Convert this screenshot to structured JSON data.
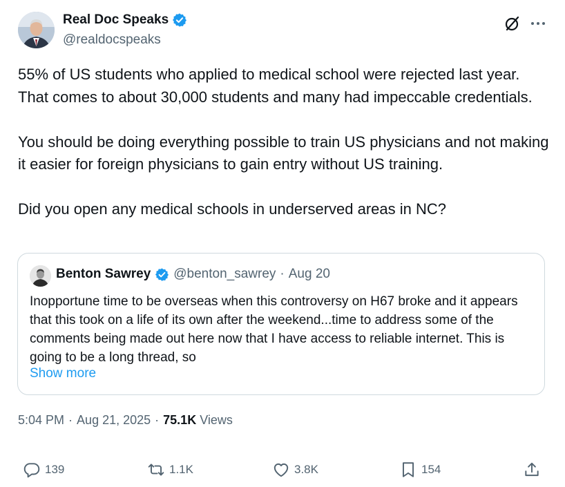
{
  "author": {
    "display_name": "Real Doc Speaks",
    "handle": "@realdocspeaks",
    "verified": true
  },
  "header_icons": {
    "grok": "grok-icon",
    "more": "more-icon"
  },
  "tweet": {
    "paragraphs": [
      "55% of US students who applied to medical school were rejected last year.  That comes to about 30,000 students and many had impeccable credentials.",
      "You should be doing everything possible to train US physicians and not making it easier for foreign physicians to gain entry without US training.",
      "Did you open any medical schools in underserved areas in NC?"
    ]
  },
  "quote": {
    "display_name": "Benton Sawrey",
    "handle": "@benton_sawrey",
    "separator": "·",
    "date": "Aug 20",
    "text": "Inopportune time to be overseas when this controversy on H67 broke and it appears that this took on a life of its own after the weekend...time to address some of the comments being made out here now that I have access to reliable internet.  This is going to be a long thread, so",
    "show_more": "Show more"
  },
  "meta": {
    "time": "5:04 PM",
    "sep1": "·",
    "date": "Aug 21, 2025",
    "sep2": "·",
    "views_count": "75.1K",
    "views_label": "Views"
  },
  "actions": {
    "replies": "139",
    "reposts": "1.1K",
    "likes": "3.8K",
    "bookmarks": "154"
  },
  "colors": {
    "verified_blue": "#1d9bf0",
    "secondary_text": "#536471",
    "border": "#cfd9de",
    "link": "#1d9bf0"
  }
}
